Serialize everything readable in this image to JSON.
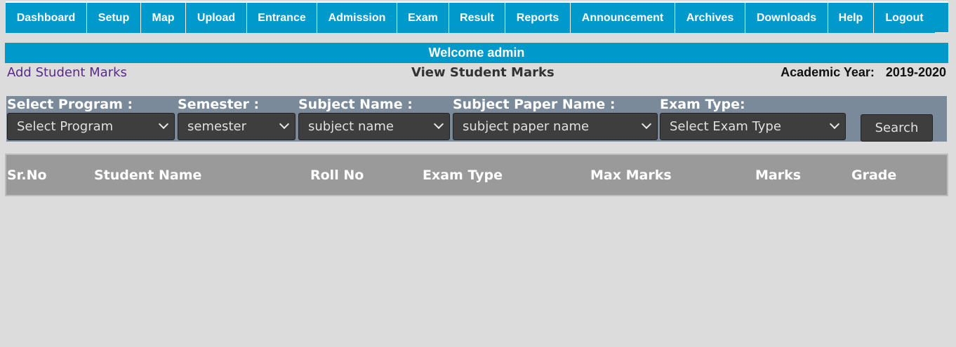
{
  "nav": {
    "items": [
      {
        "label": "Dashboard"
      },
      {
        "label": "Setup"
      },
      {
        "label": "Map"
      },
      {
        "label": "Upload"
      },
      {
        "label": "Entrance"
      },
      {
        "label": "Admission"
      },
      {
        "label": "Exam"
      },
      {
        "label": "Result"
      },
      {
        "label": "Reports"
      },
      {
        "label": "Announcement"
      },
      {
        "label": "Archives"
      },
      {
        "label": "Downloads"
      },
      {
        "label": "Help"
      },
      {
        "label": "Logout"
      }
    ]
  },
  "welcome": "Welcome admin",
  "links": {
    "add_marks": "Add Student Marks",
    "view_marks": "View Student Marks"
  },
  "academic_year": {
    "label": "Academic Year:",
    "value": "2019-2020"
  },
  "filters": {
    "program": {
      "label": "Select Program :",
      "value": "Select Program"
    },
    "semester": {
      "label": "Semester :",
      "value": "semester"
    },
    "subject": {
      "label": "Subject Name :",
      "value": "subject name"
    },
    "paper": {
      "label": "Subject Paper Name :",
      "value": "subject paper name"
    },
    "exam_type": {
      "label": "Exam Type:",
      "value": "Select Exam Type"
    },
    "search_label": "Search"
  },
  "table": {
    "columns": [
      "Sr.No",
      "Student Name",
      "Roll No",
      "Exam Type",
      "Max Marks",
      "Marks",
      "Grade"
    ]
  },
  "colors": {
    "accent": "#0099cc",
    "filter_bar": "#7a8a9a",
    "control_bg": "#3e3e3e",
    "table_header": "#9a9a9a",
    "page_bg": "#dcdcdc",
    "link": "#5a2a8a"
  }
}
